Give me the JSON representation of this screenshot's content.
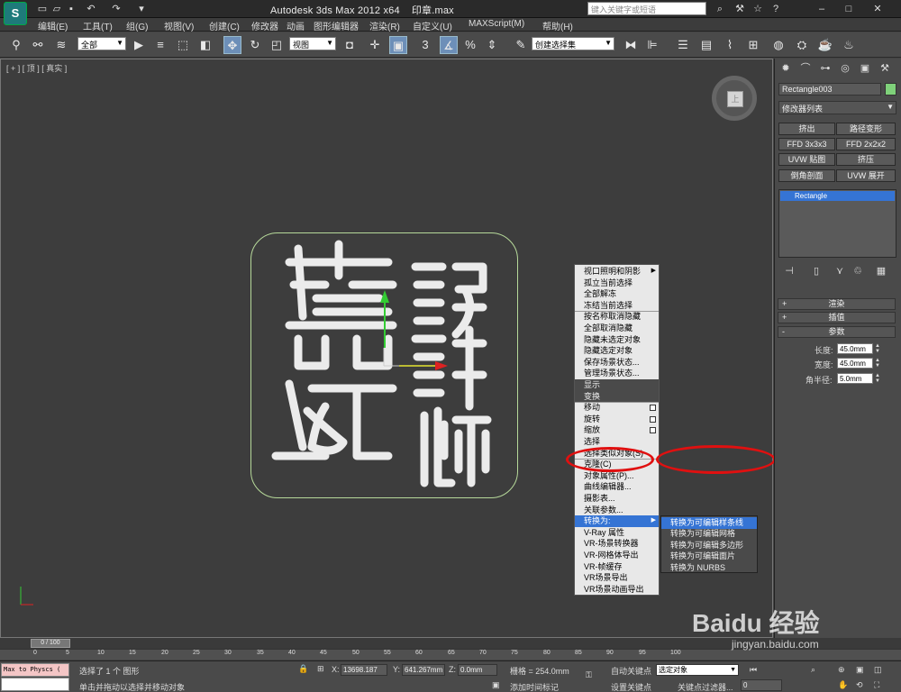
{
  "window": {
    "app_name": "Autodesk 3ds Max  2012 x64",
    "file_name": "印章.max",
    "search_placeholder": "键入关键字或短语"
  },
  "menu": [
    "编辑(E)",
    "工具(T)",
    "组(G)",
    "视图(V)",
    "创建(C)",
    "修改器",
    "动画",
    "图形编辑器",
    "渲染(R)",
    "自定义(U)",
    "MAXScript(M)",
    "帮助(H)"
  ],
  "toolbar": {
    "selection_filter": "全部",
    "reference_coord": "视图",
    "named_selection": "创建选择集",
    "snap_label": "3"
  },
  "viewport": {
    "label": "[ + ] [ 顶 ] [ 真实 ]",
    "artwork_text_left": "蘆",
    "artwork_text_left2": "囟",
    "artwork_text_right": "設計師",
    "artwork_text_right_top": "韶"
  },
  "quad_menu": {
    "items": [
      "视口照明和阴影",
      "孤立当前选择",
      "全部解冻",
      "冻结当前选择",
      "按名称取消隐藏",
      "全部取消隐藏",
      "隐藏未选定对象",
      "隐藏选定对象",
      "保存场景状态...",
      "管理场景状态...",
      "显示",
      "变换",
      "移动",
      "旋转",
      "缩放",
      "选择",
      "选择类似对象(S)",
      "克隆(C)",
      "对象属性(P)...",
      "曲线编辑器...",
      "摄影表...",
      "关联参数...",
      "转换为:",
      "V-Ray 属性",
      "VR-场景转换器",
      "VR-网格体导出",
      "VR-帧缓存",
      "VR场景导出",
      "VR场景动画导出"
    ]
  },
  "submenu": {
    "items": [
      "转换为可编辑样条线",
      "转换为可编辑网格",
      "转换为可编辑多边形",
      "转换为可编辑面片",
      "转换为 NURBS"
    ]
  },
  "command_panel": {
    "object_name": "Rectangle003",
    "object_color": "#7fd17a",
    "modifier_list": "修改器列表",
    "buttons": [
      "挤出",
      "路径变形",
      "FFD 3x3x3",
      "FFD 2x2x2",
      "UVW 贴图",
      "挤压",
      "倒角剖面",
      "UVW 展开"
    ],
    "stack_item": "Rectangle",
    "rollouts": [
      "渲染",
      "插值",
      "参数"
    ],
    "params": {
      "length_label": "长度:",
      "length": "45.0mm",
      "width_label": "宽度:",
      "width": "45.0mm",
      "corner_label": "角半径:",
      "corner": "5.0mm"
    }
  },
  "timeline": {
    "frame_display": "0 / 100",
    "ticks": [
      "0",
      "5",
      "10",
      "15",
      "20",
      "25",
      "30",
      "35",
      "40",
      "45",
      "50",
      "55",
      "60",
      "65",
      "70",
      "75",
      "80",
      "85",
      "90",
      "95",
      "100"
    ]
  },
  "status": {
    "maxscript": "Max to Physcs (",
    "selection_text": "选择了 1 个 图形",
    "prompt_text": "单击并拖动以选择并移动对象",
    "x_label": "X:",
    "x": "13698.187",
    "y_label": "Y:",
    "y": "641.267mm",
    "z_label": "Z:",
    "z": "0.0mm",
    "grid": "栅格 = 254.0mm",
    "auto_key": "自动关键点",
    "set_key": "设置关键点",
    "selected_object": "选定对象",
    "add_time_tag": "添加时间标记",
    "key_filters": "关键点过滤器...",
    "frame": "0"
  },
  "watermark": {
    "main": "Baidu 经验",
    "sub": "jingyan.baidu.com"
  }
}
